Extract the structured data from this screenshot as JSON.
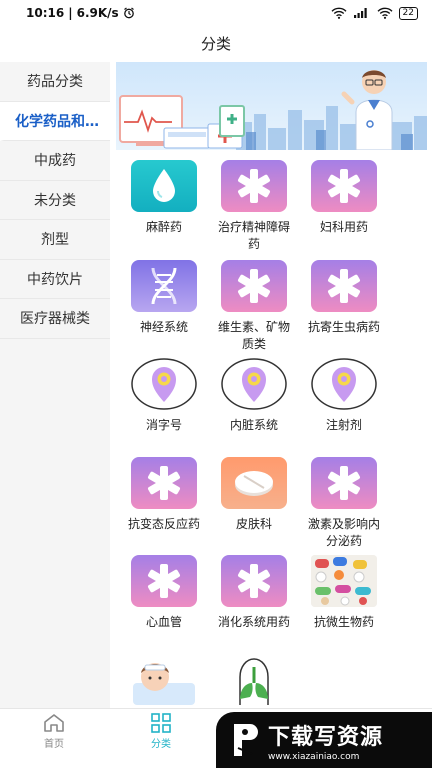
{
  "status_bar": {
    "time": "10:16",
    "speed": "6.9K/s",
    "battery": "22"
  },
  "header": {
    "title": "分类"
  },
  "sidebar": {
    "items": [
      {
        "label": "药品分类"
      },
      {
        "label": "化学药品和…"
      },
      {
        "label": "中成药"
      },
      {
        "label": "未分类"
      },
      {
        "label": "剂型"
      },
      {
        "label": "中药饮片"
      },
      {
        "label": "医疗器械类"
      }
    ]
  },
  "categories": [
    {
      "label": "麻醉药",
      "icon": "water-drop-icon"
    },
    {
      "label": "治疗精神障碍药",
      "icon": "medical-star-icon"
    },
    {
      "label": "妇科用药",
      "icon": "medical-star-icon"
    },
    {
      "label": "神经系统",
      "icon": "dna-icon"
    },
    {
      "label": "维生素、矿物质类",
      "icon": "medical-star-icon"
    },
    {
      "label": "抗寄生虫病药",
      "icon": "medical-star-icon"
    },
    {
      "label": "消字号",
      "icon": "location-pin-icon"
    },
    {
      "label": "内脏系统",
      "icon": "location-pin-icon"
    },
    {
      "label": "注射剂",
      "icon": "location-pin-icon"
    },
    {
      "label": "抗变态反应药",
      "icon": "medical-star-icon"
    },
    {
      "label": "皮肤科",
      "icon": "pill-icon"
    },
    {
      "label": "激素及影响内分泌药",
      "icon": "medical-star-icon"
    },
    {
      "label": "心血管",
      "icon": "medical-star-icon"
    },
    {
      "label": "消化系统用药",
      "icon": "medical-star-icon"
    },
    {
      "label": "抗微生物药",
      "icon": "pills-photo"
    },
    {
      "label": "",
      "icon": "sick-child-illustration"
    },
    {
      "label": "",
      "icon": "lungs-illustration"
    }
  ],
  "tabbar": {
    "items": [
      {
        "label": "首页",
        "icon": "home-icon"
      },
      {
        "label": "分类",
        "icon": "grid-icon"
      }
    ]
  },
  "watermark": {
    "text": "下载写资源",
    "sub": "www.xiazainiao.com"
  },
  "colors": {
    "accent": "#1a5fc7",
    "tab_active": "#22b3c7",
    "tile_gradient_top": "#a57fe6",
    "tile_gradient_bottom": "#ee8cc2"
  }
}
